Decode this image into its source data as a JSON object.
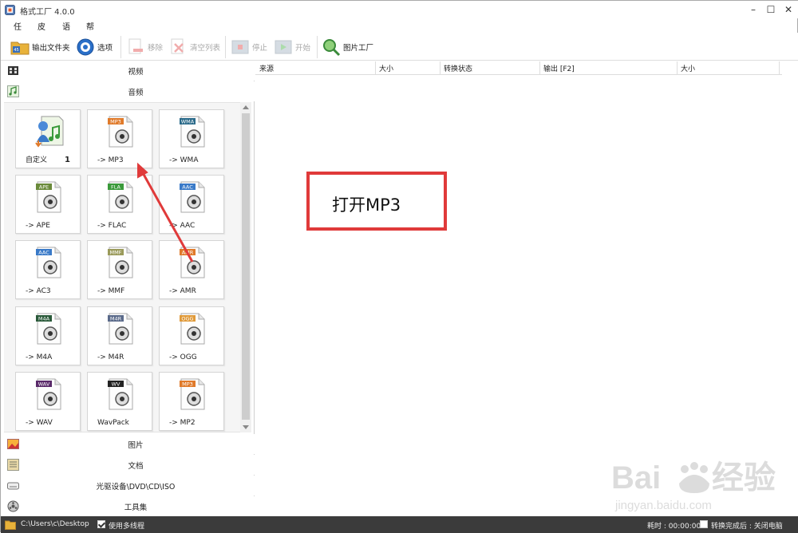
{
  "window": {
    "title": "格式工厂 4.0.0"
  },
  "menu": [
    "任务",
    "皮肤",
    "语言",
    "帮助"
  ],
  "toolbar": {
    "output_folder": "输出文件夹",
    "options": "选项",
    "remove": "移除",
    "clear_list": "清空列表",
    "stop": "停止",
    "start": "开始",
    "picture_factory": "图片工厂"
  },
  "categories": {
    "video": "视频",
    "audio": "音频",
    "picture": "图片",
    "document": "文档",
    "disc": "光驱设备\\DVD\\CD\\ISO",
    "tools": "工具集"
  },
  "tiles": [
    {
      "label": "自定义",
      "icon": "custom-audio-icon",
      "badge": "",
      "count": "1"
    },
    {
      "label": "-> MP3",
      "icon": "mp3-icon",
      "badge": "MP3"
    },
    {
      "label": "-> WMA",
      "icon": "wma-icon",
      "badge": "WMA"
    },
    {
      "label": "-> APE",
      "icon": "ape-icon",
      "badge": "APE"
    },
    {
      "label": "-> FLAC",
      "icon": "flac-icon",
      "badge": "FLA"
    },
    {
      "label": "-> AAC",
      "icon": "aac-icon",
      "badge": "AAC"
    },
    {
      "label": "-> AC3",
      "icon": "ac3-icon",
      "badge": "AAC"
    },
    {
      "label": "-> MMF",
      "icon": "mmf-icon",
      "badge": "MMF"
    },
    {
      "label": "-> AMR",
      "icon": "amr-icon",
      "badge": "AMR"
    },
    {
      "label": "-> M4A",
      "icon": "m4a-icon",
      "badge": "M4A"
    },
    {
      "label": "-> M4R",
      "icon": "m4r-icon",
      "badge": "M4R"
    },
    {
      "label": "-> OGG",
      "icon": "ogg-icon",
      "badge": "OGG"
    },
    {
      "label": "-> WAV",
      "icon": "wav-icon",
      "badge": "WAV"
    },
    {
      "label": "WavPack",
      "icon": "wavpack-icon",
      "badge": "WV"
    },
    {
      "label": "-> MP2",
      "icon": "mp2-icon",
      "badge": "MP3"
    }
  ],
  "table": {
    "columns": [
      "来源",
      "大小",
      "转换状态",
      "输出 [F2]",
      "大小"
    ]
  },
  "annotation": {
    "text": "打开MP3"
  },
  "status": {
    "path": "C:\\Users\\c\\Desktop",
    "multithread": "使用多线程",
    "elapsed": "耗时 : 00:00:00",
    "after_convert": "转换完成后 : 关闭电脑"
  },
  "colors": {
    "annotation_red": "#e03a3a",
    "statusbar": "#3b3b3b"
  }
}
